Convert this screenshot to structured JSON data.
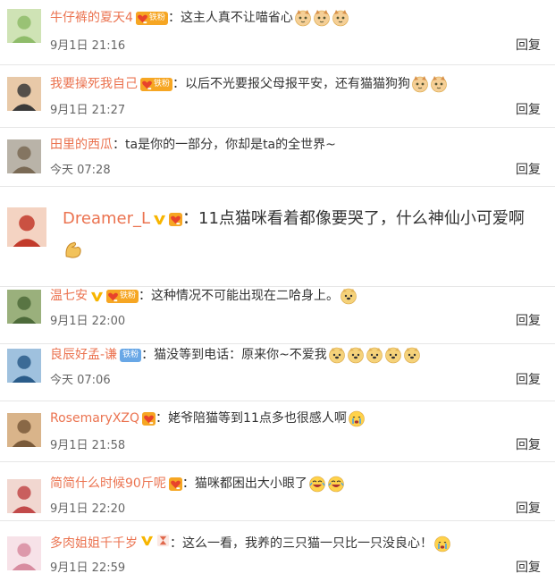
{
  "comments": [
    {
      "user": "牛仔裤的夏天4",
      "sep": "：",
      "text": "这主人真不让喵省心",
      "emojis": [
        "cat-emoji",
        "cat-emoji",
        "cat-emoji"
      ],
      "badge": "fan",
      "badge_text": "铁粉",
      "vip": false,
      "time": "9月1日 21:16",
      "reply": "回复"
    },
    {
      "user": "我要操死我自己",
      "sep": "：",
      "text": "以后不光要报父母报平安，还有猫猫狗狗",
      "emojis": [
        "cat-emoji",
        "cat-emoji"
      ],
      "badge": "fan",
      "badge_text": "铁粉",
      "vip": false,
      "time": "9月1日 21:27",
      "reply": "回复"
    },
    {
      "user": "田里的西瓜",
      "sep": "：",
      "text": "ta是你的一部分，你却是ta的全世界~",
      "emojis": [],
      "badge": "none",
      "badge_text": "",
      "vip": false,
      "time": "今天 07:28",
      "reply": "回复"
    },
    {
      "user": "Dreamer_L",
      "sep": "：",
      "text": "11点猫咪看着都像要哭了，什么神仙小可爱啊",
      "emojis": [
        "strong-arm-emoji"
      ],
      "badge": "heart",
      "badge_text": "",
      "vip": true,
      "time": "",
      "reply": ""
    },
    {
      "user": "温七安",
      "sep": "：",
      "text": "这种情况不可能出现在二哈身上。",
      "emojis": [
        "doge-emoji"
      ],
      "badge": "fan",
      "badge_text": "铁粉",
      "vip": true,
      "time": "9月1日 22:00",
      "reply": "回复"
    },
    {
      "user": "良辰好孟-谦",
      "sep": "：",
      "text": "猫没等到电话：原来你~不爱我",
      "emojis": [
        "doge-emoji",
        "doge-emoji",
        "doge-emoji",
        "doge-emoji",
        "doge-emoji"
      ],
      "badge": "blue",
      "badge_text": "铁粉",
      "vip": false,
      "time": "今天 07:06",
      "reply": "回复"
    },
    {
      "user": "RosemaryXZQ",
      "sep": "：",
      "text": "姥爷陪猫等到11点多也很感人啊",
      "emojis": [
        "cry-emoji"
      ],
      "badge": "heart",
      "badge_text": "",
      "vip": false,
      "time": "9月1日 21:58",
      "reply": "回复"
    },
    {
      "user": "简简什么时候90斤呢",
      "sep": "：",
      "text": "猫咪都困出大小眼了",
      "emojis": [
        "laugh-emoji",
        "laugh-emoji"
      ],
      "badge": "heart",
      "badge_text": "",
      "vip": false,
      "time": "9月1日 22:20",
      "reply": "回复"
    },
    {
      "user": "多肉姐姐千千岁",
      "sep": "：",
      "text": "这么一看，我养的三只猫一只比一只没良心！",
      "emojis": [
        "cry-emoji"
      ],
      "badge": "hourglass",
      "badge_text": "",
      "vip": true,
      "time": "9月1日 22:59",
      "reply": "回复"
    }
  ]
}
